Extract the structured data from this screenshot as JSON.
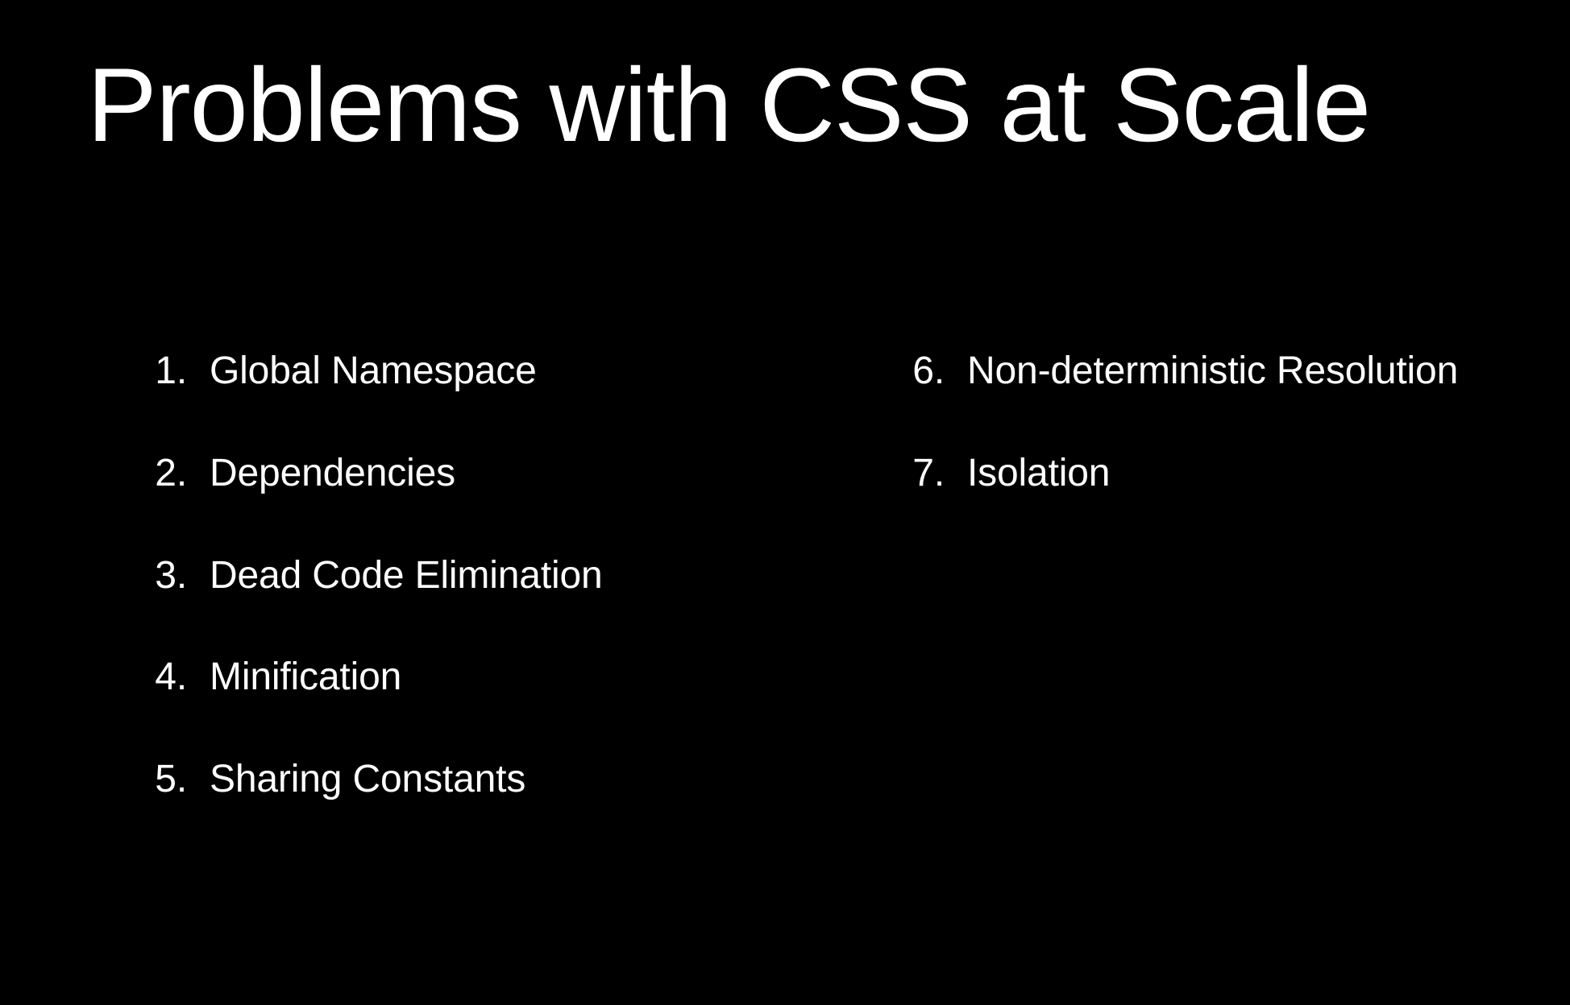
{
  "title": "Problems with CSS at Scale",
  "columns": {
    "left": [
      {
        "number": "1.",
        "text": "Global Namespace"
      },
      {
        "number": "2.",
        "text": "Dependencies"
      },
      {
        "number": "3.",
        "text": "Dead Code Elimination"
      },
      {
        "number": "4.",
        "text": "Minification"
      },
      {
        "number": "5.",
        "text": "Sharing Constants"
      }
    ],
    "right": [
      {
        "number": "6.",
        "text": "Non-deterministic Resolution"
      },
      {
        "number": "7.",
        "text": "Isolation"
      }
    ]
  }
}
